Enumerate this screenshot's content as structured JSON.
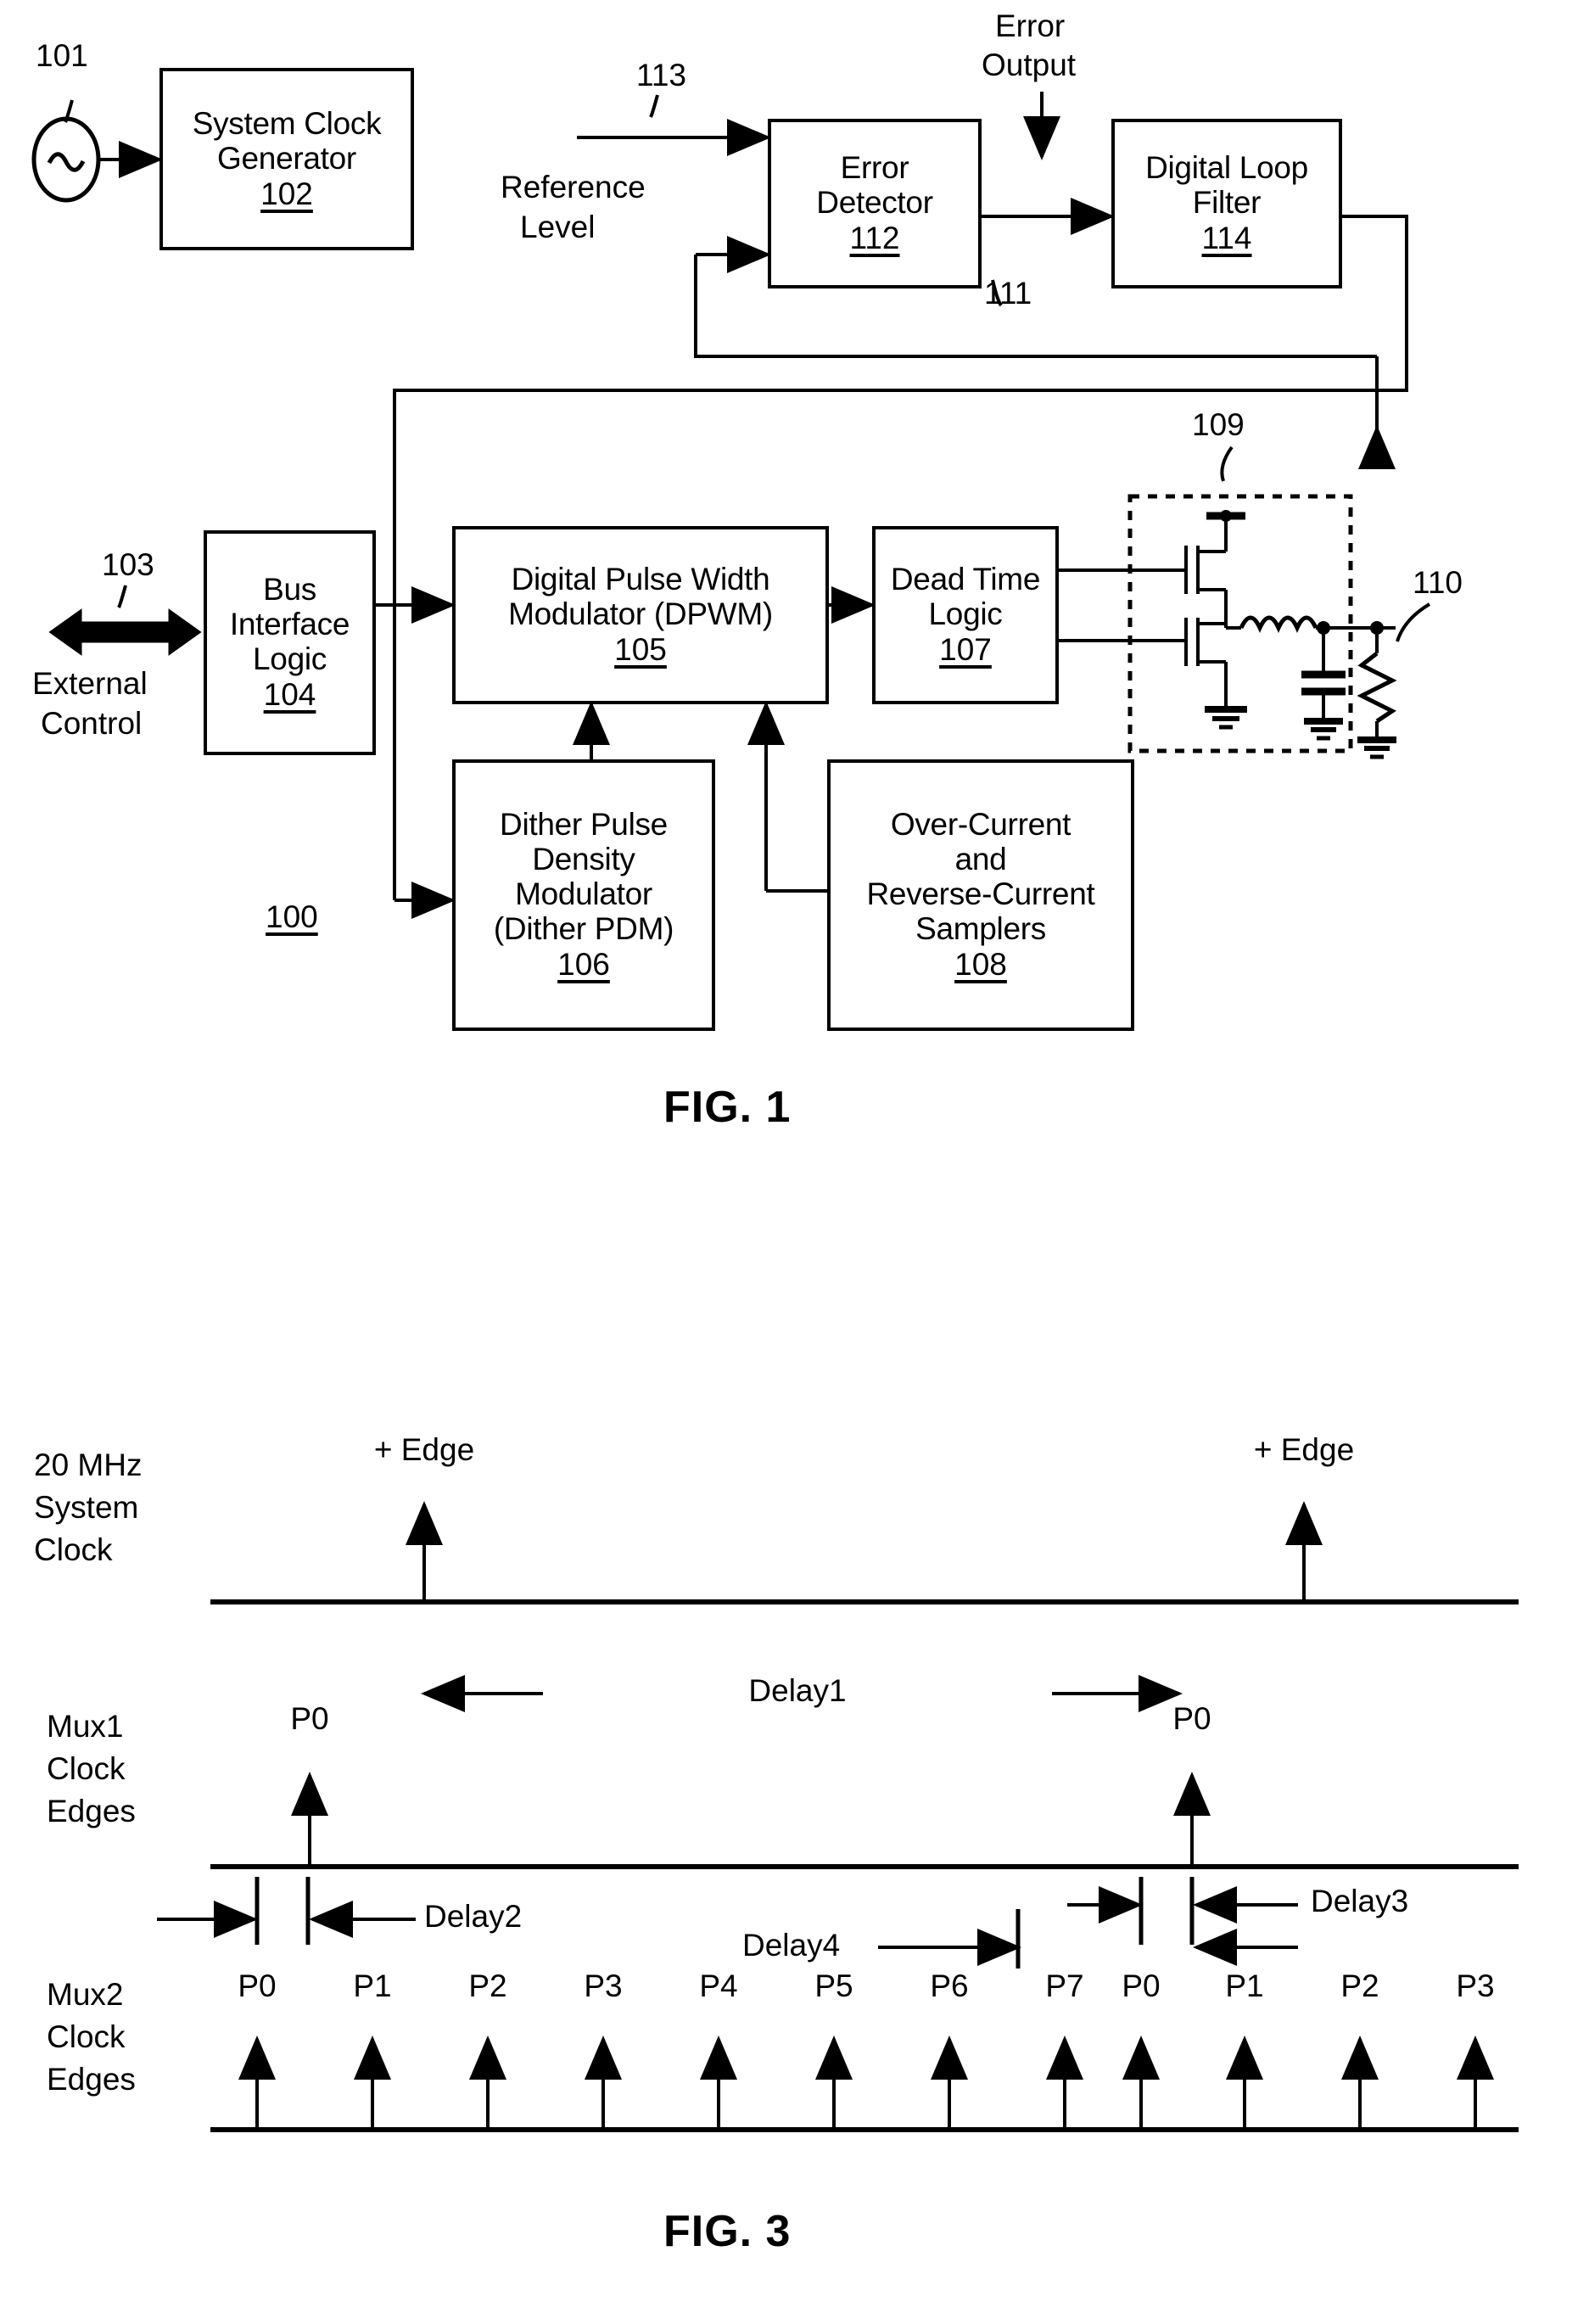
{
  "figure1": {
    "caption": "FIG. 1",
    "system_ref": "100",
    "refs": {
      "osc": "101",
      "bus_iface": "103",
      "err_det_in": "113",
      "feedback": "111",
      "power_stage": "109",
      "load": "110"
    },
    "labels": {
      "external_control": "External\nControl",
      "external_control_l1": "External",
      "external_control_l2": "Control",
      "reference_level_l1": "Reference",
      "reference_level_l2": "Level",
      "error_output_l1": "Error",
      "error_output_l2": "Output"
    },
    "blocks": [
      {
        "id": "system-clock-generator",
        "lines": [
          "System Clock",
          "Generator"
        ],
        "num": "102"
      },
      {
        "id": "error-detector",
        "lines": [
          "Error",
          "Detector"
        ],
        "num": "112"
      },
      {
        "id": "digital-loop-filter",
        "lines": [
          "Digital Loop",
          "Filter"
        ],
        "num": "114"
      },
      {
        "id": "bus-interface-logic",
        "lines": [
          "Bus",
          "Interface",
          "Logic"
        ],
        "num": "104"
      },
      {
        "id": "digital-pulse-width-modulator",
        "lines": [
          "Digital Pulse Width",
          "Modulator (DPWM)"
        ],
        "num": "105"
      },
      {
        "id": "dead-time-logic",
        "lines": [
          "Dead Time",
          "Logic"
        ],
        "num": "107"
      },
      {
        "id": "dither-pulse-density-modulator",
        "lines": [
          "Dither Pulse",
          "Density",
          "Modulator",
          "(Dither PDM)"
        ],
        "num": "106"
      },
      {
        "id": "over-current-reverse-current-samplers",
        "lines": [
          "Over-Current",
          "and",
          "Reverse-Current",
          "Samplers"
        ],
        "num": "108"
      }
    ]
  },
  "figure3": {
    "caption": "FIG. 3",
    "rows": [
      {
        "id": "system-clock-row",
        "label_lines": [
          "20 MHz",
          "System",
          "Clock"
        ],
        "markers": [
          "+ Edge",
          "+ Edge"
        ]
      },
      {
        "id": "mux1-row",
        "label_lines": [
          "Mux1",
          "Clock",
          "Edges"
        ],
        "markers": [
          "P0",
          "P0"
        ]
      },
      {
        "id": "mux2-row",
        "label_lines": [
          "Mux2",
          "Clock",
          "Edges"
        ],
        "markers": [
          "P0",
          "P1",
          "P2",
          "P3",
          "P4",
          "P5",
          "P6",
          "P7",
          "P0",
          "P1",
          "P2",
          "P3"
        ]
      }
    ],
    "delays": {
      "d1": "Delay1",
      "d2": "Delay2",
      "d3": "Delay3",
      "d4": "Delay4"
    }
  },
  "colors": {
    "ink": "#000000",
    "paper": "#ffffff"
  }
}
